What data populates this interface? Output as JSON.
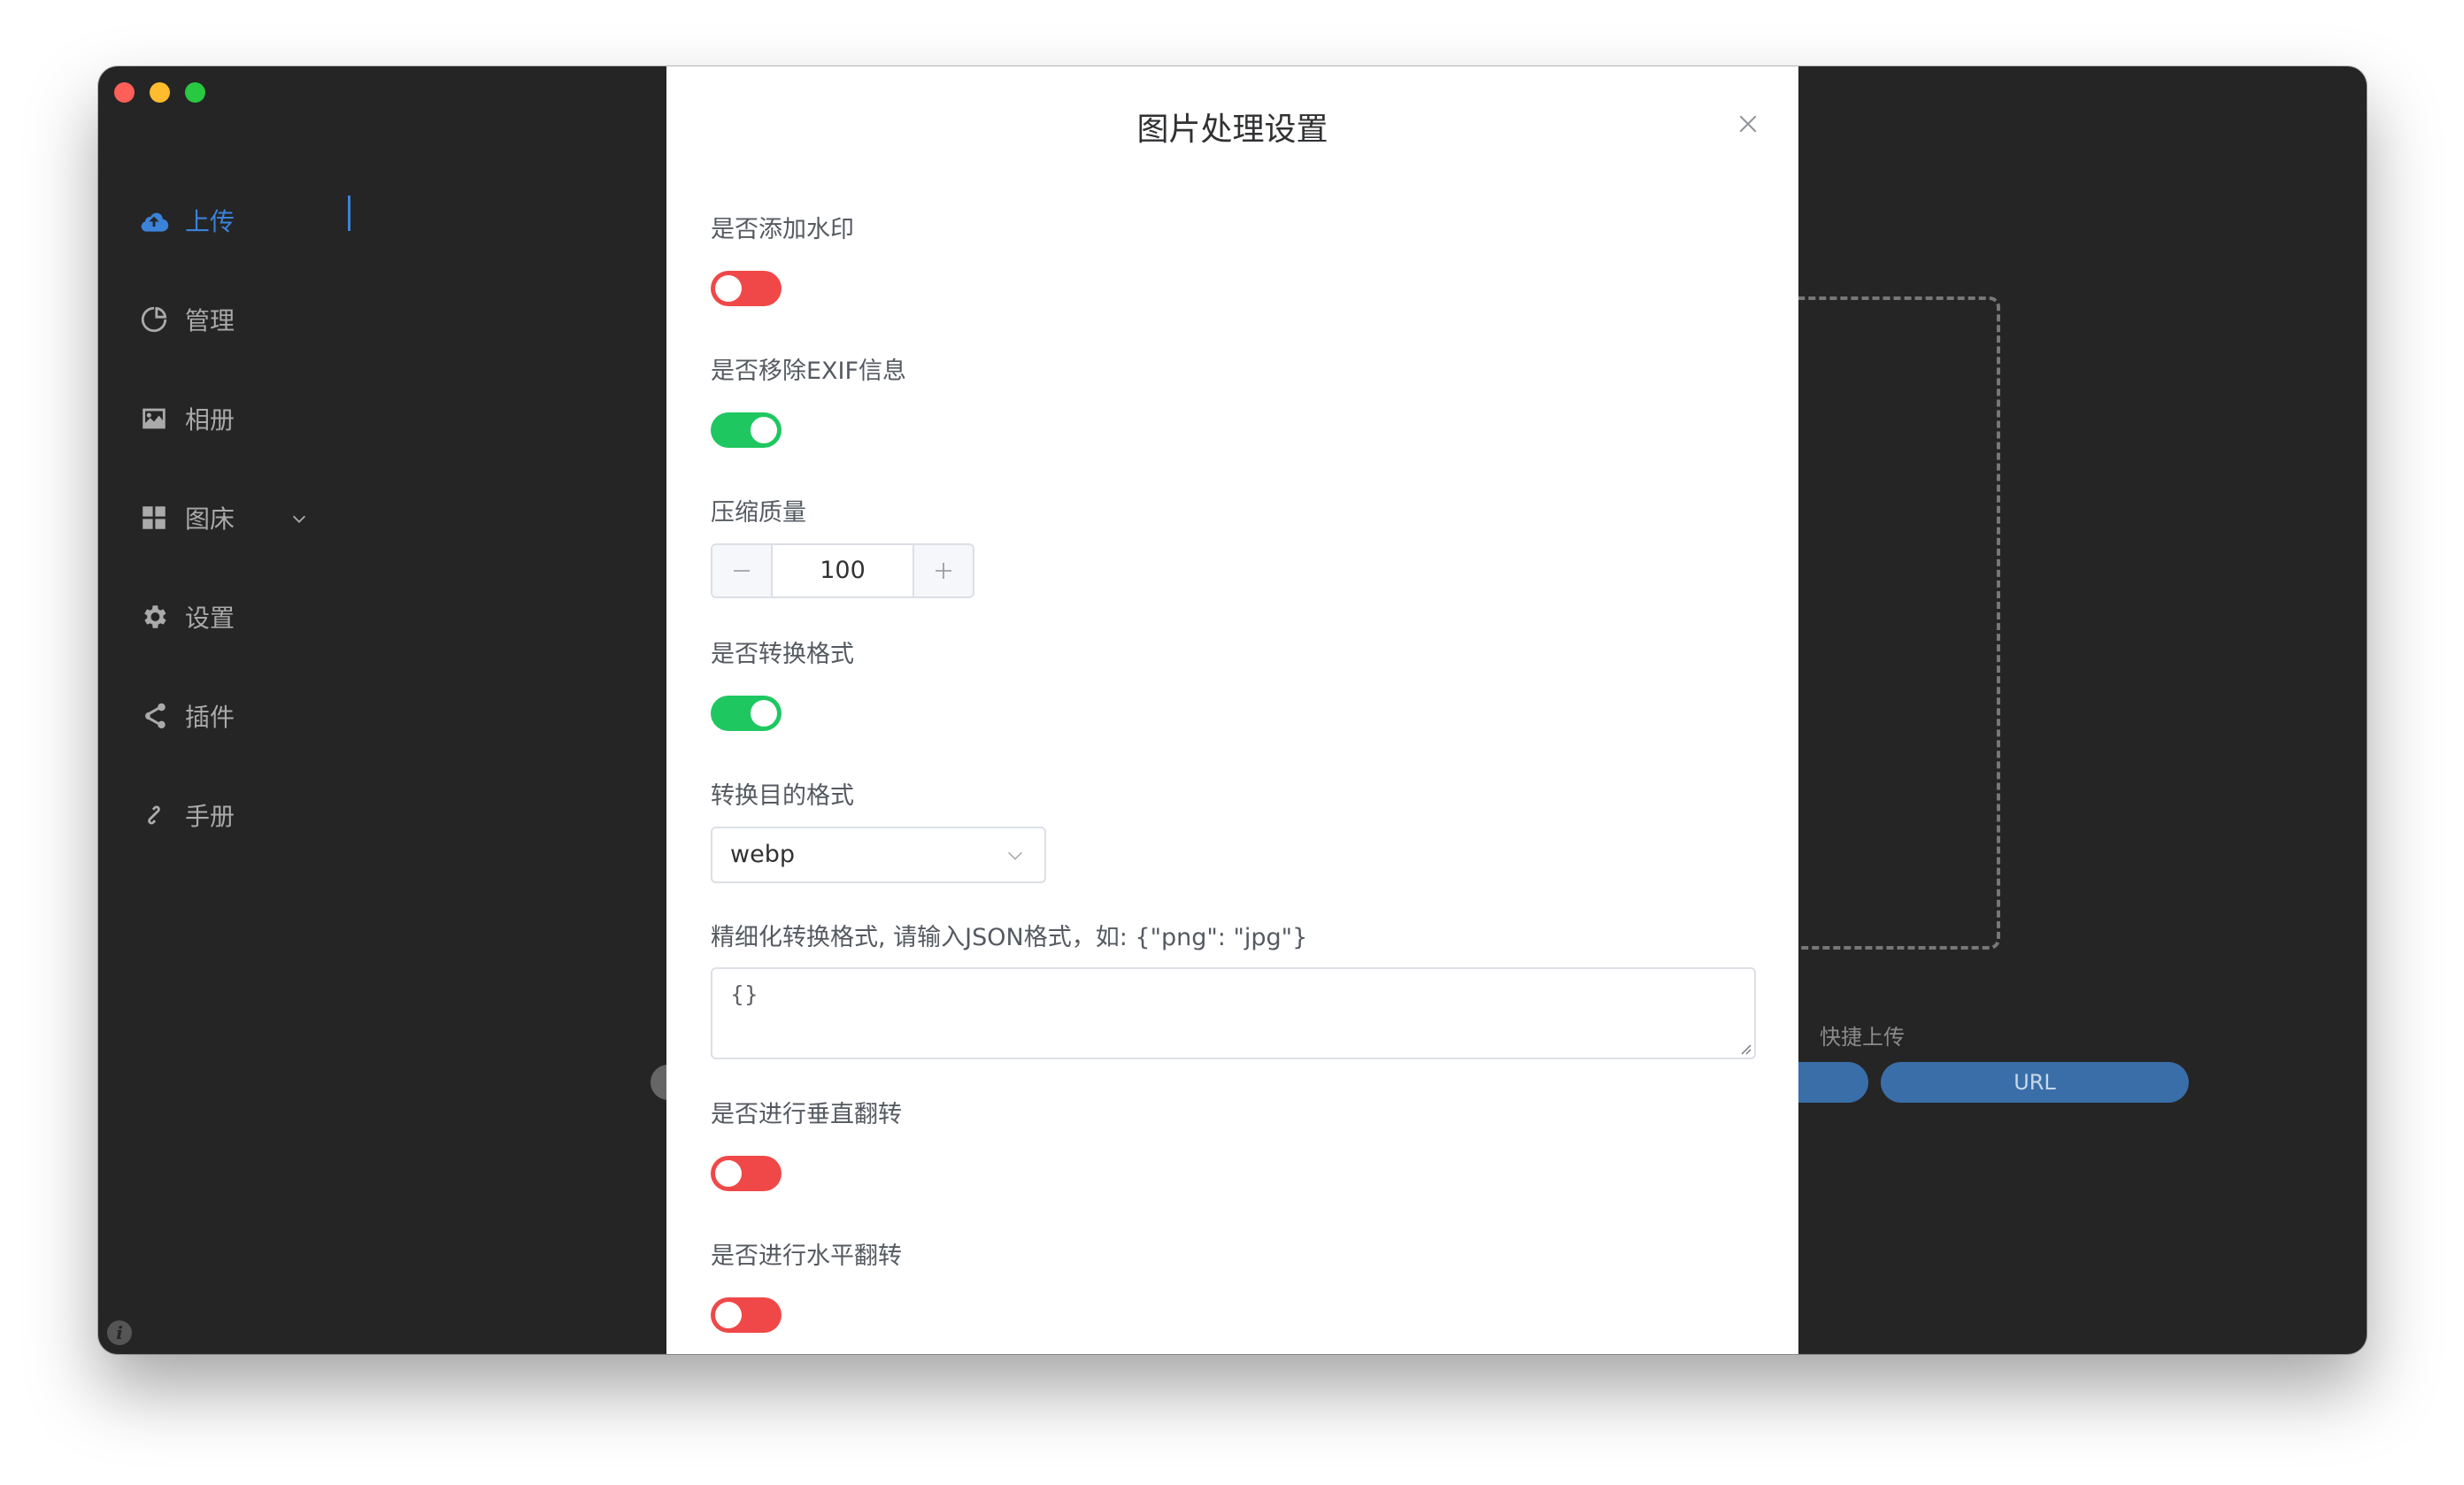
{
  "sidebar": {
    "items": [
      {
        "label": "上传",
        "icon": "cloud-upload-icon",
        "active": true
      },
      {
        "label": "管理",
        "icon": "pie-chart-icon"
      },
      {
        "label": "相册",
        "icon": "picture-icon"
      },
      {
        "label": "图床",
        "icon": "grid-icon"
      },
      {
        "label": "设置",
        "icon": "gear-icon"
      },
      {
        "label": "插件",
        "icon": "share-icon"
      },
      {
        "label": "手册",
        "icon": "link-icon"
      }
    ]
  },
  "background": {
    "quick_upload_label": "快捷上传",
    "url_button": "URL"
  },
  "modal": {
    "title": "图片处理设置",
    "fields": {
      "watermark": {
        "label": "是否添加水印",
        "value": false
      },
      "remove_exif": {
        "label": "是否移除EXIF信息",
        "value": true
      },
      "quality": {
        "label": "压缩质量",
        "value": "100"
      },
      "convert_format": {
        "label": "是否转换格式",
        "value": true
      },
      "target_format": {
        "label": "转换目的格式",
        "value": "webp"
      },
      "format_map": {
        "label": "精细化转换格式, 请输入JSON格式，如: {\"png\": \"jpg\"}",
        "value": "{}"
      },
      "flip_vertical": {
        "label": "是否进行垂直翻转",
        "value": false
      },
      "flip_horizontal": {
        "label": "是否进行水平翻转",
        "value": false
      }
    }
  },
  "colors": {
    "switch_on": "#1ec760",
    "switch_off": "#f04848",
    "accent": "#3b82d9"
  }
}
